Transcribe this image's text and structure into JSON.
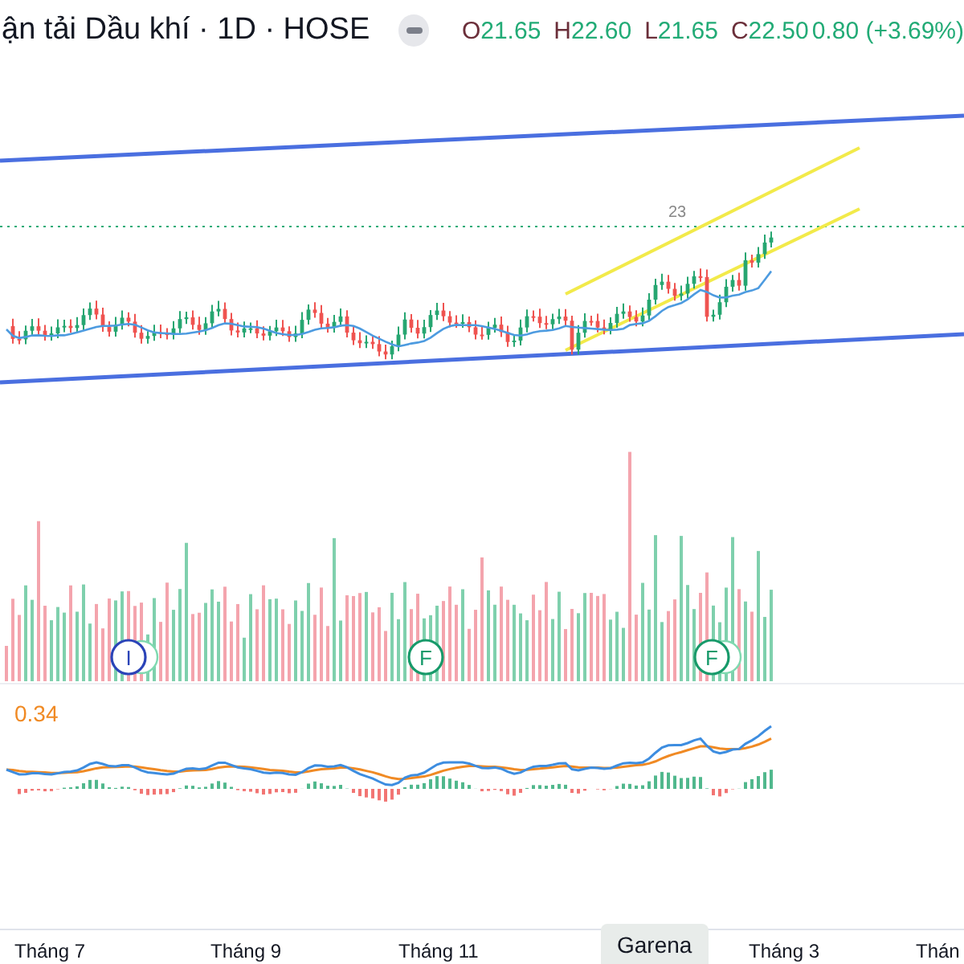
{
  "header": {
    "title": "ận tải Dầu khí · 1D · HOSE",
    "ohlc": [
      {
        "label": "O",
        "value": "21.65"
      },
      {
        "label": "H",
        "value": "22.60"
      },
      {
        "label": "L",
        "value": "21.65"
      },
      {
        "label": "C",
        "value": "22.50"
      }
    ],
    "change": "0.80 (+3.69%)"
  },
  "price_pane": {
    "kind": "picture",
    "price_label": "23",
    "events": [
      {
        "letter": "I",
        "color": "#2b44b8"
      },
      {
        "letter": "F",
        "color": "#179a6a"
      },
      {
        "letter": "F",
        "color": "#179a6a"
      }
    ]
  },
  "macd_pane": {
    "kind": "picture",
    "value": "0.34"
  },
  "time_axis": [
    {
      "text": "Tháng 7",
      "kind": "month"
    },
    {
      "text": "Tháng 9",
      "kind": "month"
    },
    {
      "text": "Tháng 11",
      "kind": "month"
    },
    {
      "text": "Garena",
      "kind": "cursor"
    },
    {
      "text": "Tháng 3",
      "kind": "month"
    },
    {
      "text": "Thán",
      "kind": "month"
    }
  ]
}
